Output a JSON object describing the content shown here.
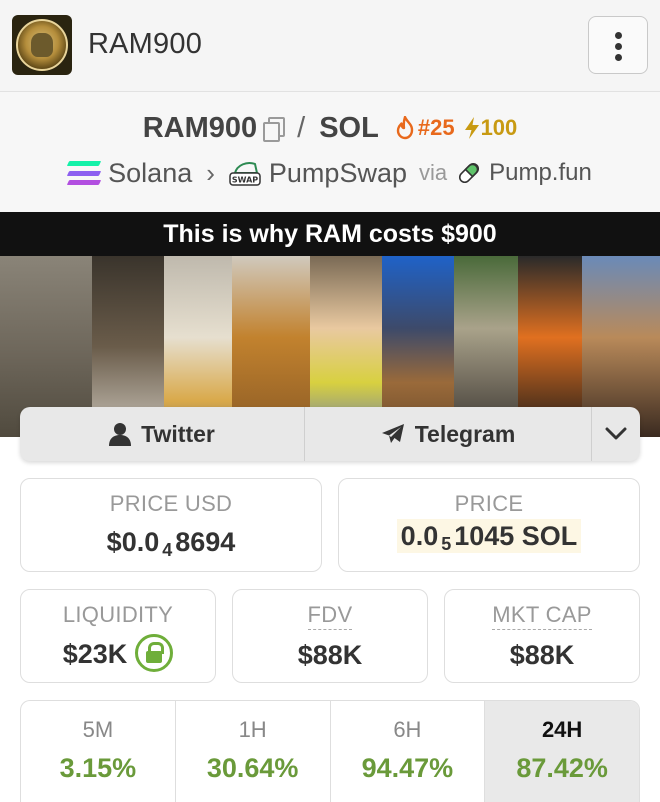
{
  "header": {
    "title": "RAM900",
    "menu_icon": "kebab-menu-icon"
  },
  "pair": {
    "base": "RAM900",
    "separator": "/",
    "quote": "SOL",
    "rank": "#25",
    "boost": "100"
  },
  "chain": {
    "network": "Solana",
    "dex": "PumpSwap",
    "via_label": "via",
    "launchpad": "Pump.fun",
    "dex_badge": "SWAP"
  },
  "banner": {
    "caption": "This is why RAM costs $900"
  },
  "social": {
    "twitter": "Twitter",
    "telegram": "Telegram"
  },
  "stats": {
    "price_usd_label": "PRICE USD",
    "price_usd_prefix": "$0.0",
    "price_usd_zeros": "4",
    "price_usd_digits": "8694",
    "price_native_label": "PRICE",
    "price_native_prefix": "0.0",
    "price_native_zeros": "5",
    "price_native_digits": "1045 SOL",
    "liquidity_label": "LIQUIDITY",
    "liquidity_value": "$23K",
    "fdv_label": "FDV",
    "fdv_value": "$88K",
    "mktcap_label": "MKT CAP",
    "mktcap_value": "$88K"
  },
  "timeframes": [
    {
      "label": "5M",
      "change": "3.15%"
    },
    {
      "label": "1H",
      "change": "30.64%"
    },
    {
      "label": "6H",
      "change": "94.47%"
    },
    {
      "label": "24H",
      "change": "87.42%"
    }
  ],
  "colors": {
    "positive": "#6a9a3a",
    "rank": "#e8691c",
    "boost": "#c89a12",
    "lock": "#6fae3a"
  }
}
